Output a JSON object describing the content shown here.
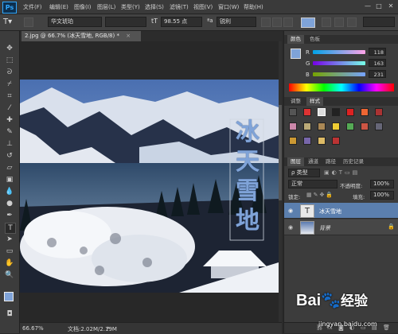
{
  "app": {
    "logo": "Ps"
  },
  "menu": [
    "文件(F)",
    "编辑(E)",
    "图像(I)",
    "图层(L)",
    "类型(Y)",
    "选择(S)",
    "滤镜(T)",
    "视图(V)",
    "窗口(W)",
    "帮助(H)"
  ],
  "window_buttons": [
    "—",
    "□",
    "✕"
  ],
  "options": {
    "font_family": "华文琥珀",
    "font_style": "",
    "font_size": "98.55 点",
    "anti_alias": "锐利",
    "aa_label": "ªa"
  },
  "document": {
    "tab_title": "2.jpg @ 66.7% (冰天雪地, RGB/8) *",
    "tab_close": "×",
    "vertical_text": [
      "冰",
      "天",
      "雪",
      "地"
    ]
  },
  "status": {
    "zoom": "66.67%",
    "doc_info": "文档:2.02M/2.19M"
  },
  "color_panel": {
    "tabs": [
      "颜色",
      "色板"
    ],
    "R": {
      "label": "R",
      "value": "118"
    },
    "G": {
      "label": "G",
      "value": "163"
    },
    "B": {
      "label": "B",
      "value": "231"
    },
    "foreground": "#7fa3d8"
  },
  "styles_panel": {
    "tabs": [
      "调整",
      "样式"
    ]
  },
  "layers_panel": {
    "tabs": [
      "图层",
      "通道",
      "路径",
      "历史记录"
    ],
    "filter_kind": "ρ 类型",
    "blend_mode": "正常",
    "opacity_label": "不透明度:",
    "opacity_value": "100%",
    "lock_label": "锁定:",
    "fill_label": "填充:",
    "fill_value": "100%",
    "layers": [
      {
        "name": "冰天雪地",
        "thumb": "T"
      },
      {
        "name": "背景",
        "thumb": ""
      }
    ],
    "footer_icons": [
      "⛓",
      "fx",
      "◙",
      "◐",
      "▭",
      "▤",
      "🗑"
    ]
  },
  "watermark": {
    "brand": "Bai",
    "brand2": "经验",
    "url": "jingyan.baidu.com"
  }
}
